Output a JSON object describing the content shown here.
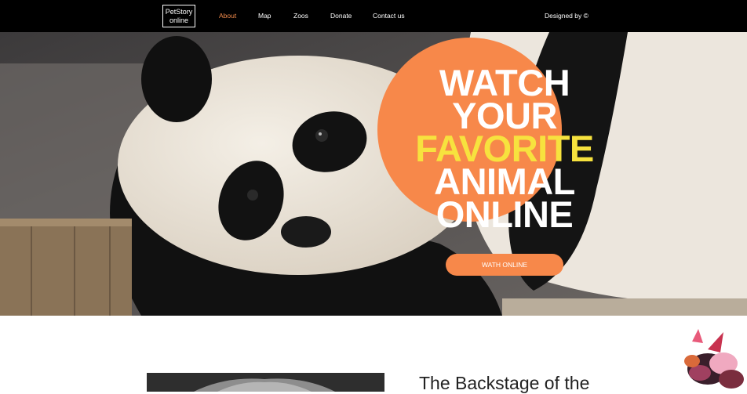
{
  "nav": {
    "logo_line1": "PetStory",
    "logo_line2": "online",
    "links": [
      "About",
      "Map",
      "Zoos",
      "Donate",
      "Contact us"
    ],
    "active": "About",
    "credit": "Designed by ©"
  },
  "hero": {
    "headline": [
      "WATCH",
      "YOUR",
      "FAVORITE",
      "ANIMAL",
      "ONLINE"
    ],
    "highlight_word": "FAVORITE",
    "button_label": "WATH ONLINE",
    "image": "panda-photo"
  },
  "section": {
    "title": "The Backstage of the"
  },
  "colors": {
    "accent": "#f7884a",
    "highlight": "#f7e23e",
    "nav_bg": "#000000",
    "active_link": "#f08a4b"
  }
}
